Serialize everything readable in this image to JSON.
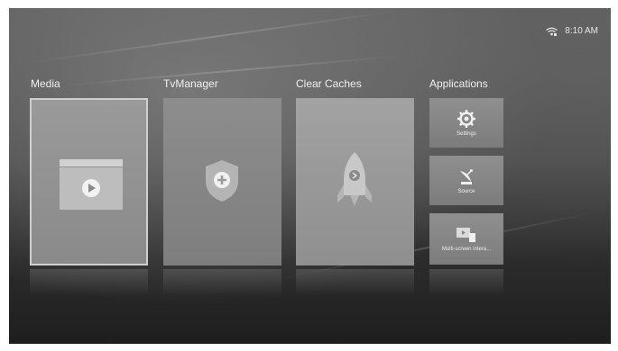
{
  "status": {
    "time": "8:10 AM",
    "wifi_icon": "wifi-icon"
  },
  "sections": [
    {
      "title": "Media",
      "icon": "play-folder-icon"
    },
    {
      "title": "TvManager",
      "icon": "shield-plus-icon"
    },
    {
      "title": "Clear Caches",
      "icon": "rocket-icon"
    },
    {
      "title": "Applications"
    }
  ],
  "apps": [
    {
      "label": "Settings",
      "icon": "gear-icon"
    },
    {
      "label": "Source",
      "icon": "satellite-dish-icon"
    },
    {
      "label": "Multi-screen intera...",
      "icon": "multi-screen-icon"
    }
  ]
}
